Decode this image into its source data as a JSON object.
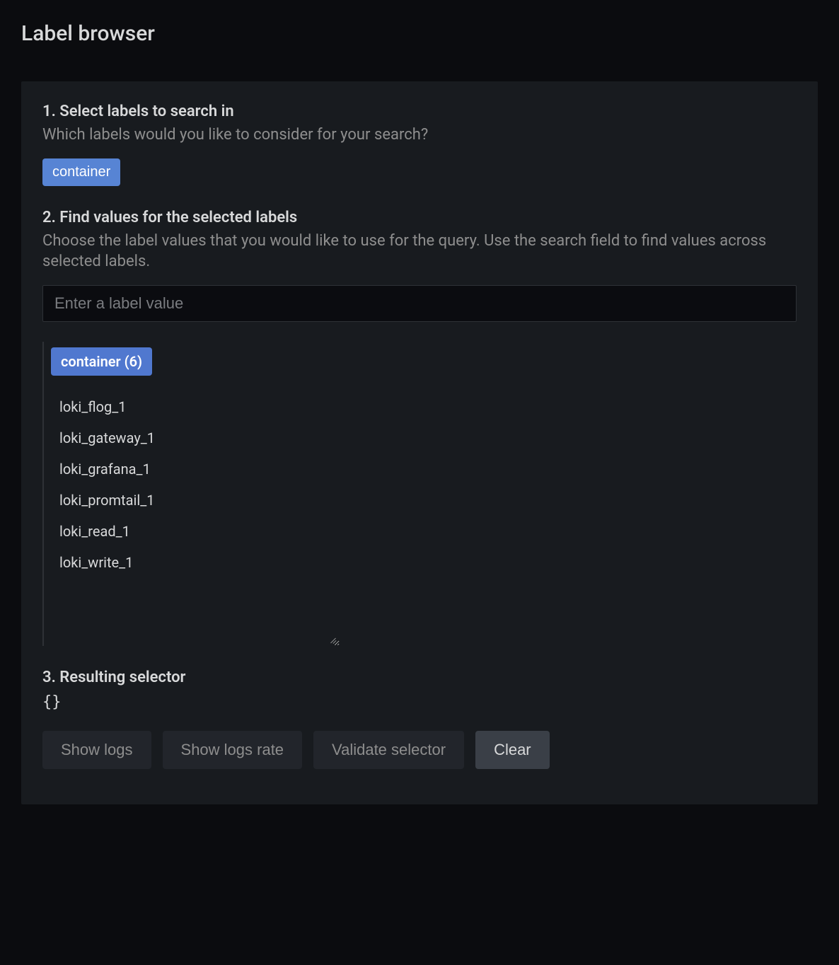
{
  "title": "Label browser",
  "section1": {
    "title": "1. Select labels to search in",
    "subtitle": "Which labels would you like to consider for your search?",
    "labels": [
      "container"
    ]
  },
  "section2": {
    "title": "2. Find values for the selected labels",
    "subtitle": "Choose the label values that you would like to use for the query. Use the search field to find values across selected labels.",
    "placeholder": "Enter a label value",
    "valuesHeader": "container (6)",
    "values": [
      "loki_flog_1",
      "loki_gateway_1",
      "loki_grafana_1",
      "loki_promtail_1",
      "loki_read_1",
      "loki_write_1"
    ]
  },
  "section3": {
    "title": "3. Resulting selector",
    "selector": "{}"
  },
  "buttons": {
    "showLogs": "Show logs",
    "showLogsRate": "Show logs rate",
    "validateSelector": "Validate selector",
    "clear": "Clear"
  }
}
